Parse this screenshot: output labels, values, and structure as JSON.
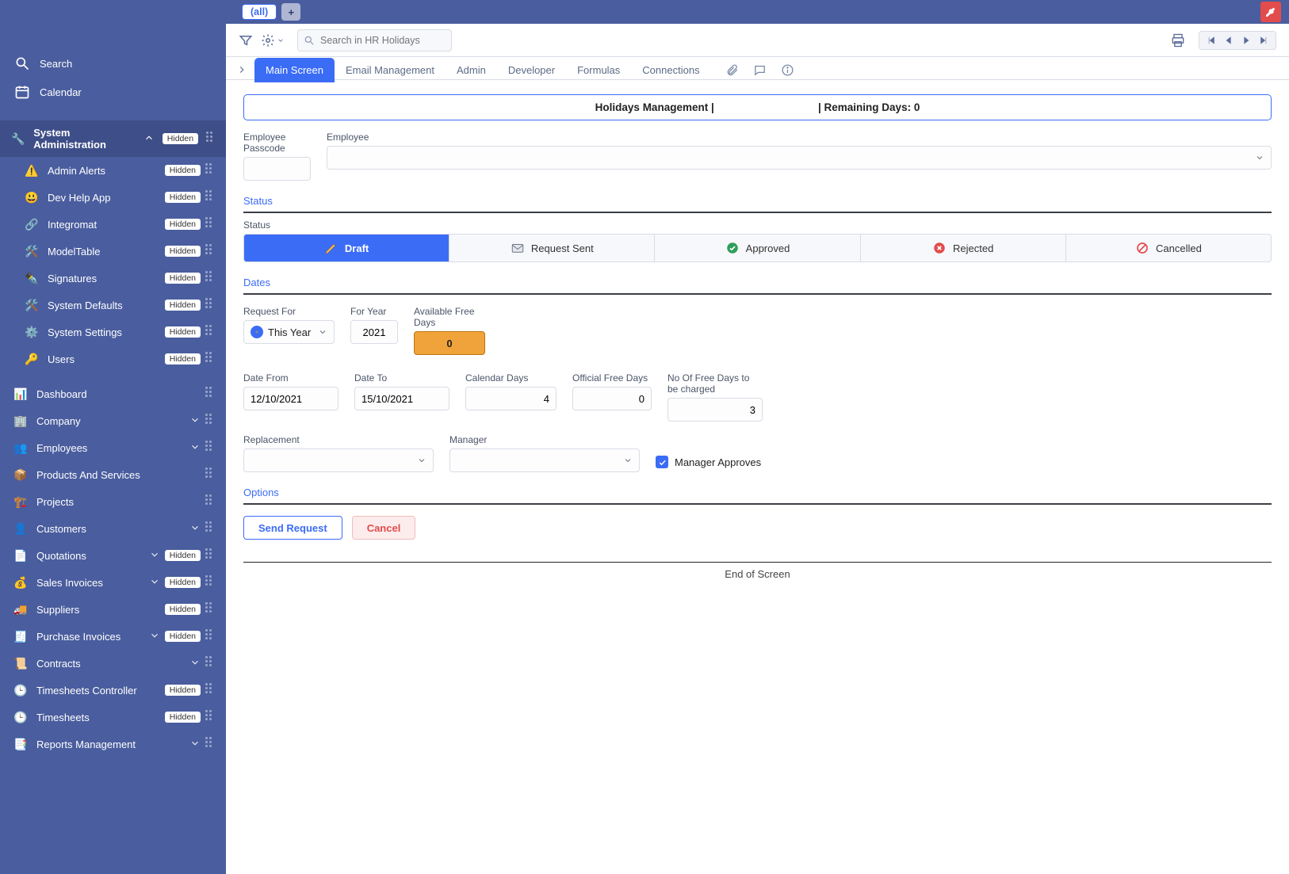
{
  "sidebar": {
    "search": "Search",
    "calendar": "Calendar",
    "groupHeader": {
      "label": "System Administration",
      "badge": "Hidden",
      "icon": "🔧"
    },
    "subitems": [
      {
        "label": "Admin Alerts",
        "badge": "Hidden",
        "icon": "⚠️"
      },
      {
        "label": "Dev Help App",
        "badge": "Hidden",
        "icon": "😃"
      },
      {
        "label": "Integromat",
        "badge": "Hidden",
        "icon": "🔗"
      },
      {
        "label": "ModelTable",
        "badge": "Hidden",
        "icon": "🛠️"
      },
      {
        "label": "Signatures",
        "badge": "Hidden",
        "icon": "✒️"
      },
      {
        "label": "System Defaults",
        "badge": "Hidden",
        "icon": "🛠️"
      },
      {
        "label": "System Settings",
        "badge": "Hidden",
        "icon": "⚙️"
      },
      {
        "label": "Users",
        "badge": "Hidden",
        "icon": "🔑"
      }
    ],
    "items": [
      {
        "label": "Dashboard",
        "icon": "📊",
        "hasChevron": false,
        "badge": null
      },
      {
        "label": "Company",
        "icon": "🏢",
        "hasChevron": true,
        "badge": null
      },
      {
        "label": "Employees",
        "icon": "👥",
        "hasChevron": true,
        "badge": null
      },
      {
        "label": "Products And Services",
        "icon": "📦",
        "hasChevron": false,
        "badge": null
      },
      {
        "label": "Projects",
        "icon": "🏗️",
        "hasChevron": false,
        "badge": null
      },
      {
        "label": "Customers",
        "icon": "👤",
        "hasChevron": true,
        "badge": null
      },
      {
        "label": "Quotations",
        "icon": "📄",
        "hasChevron": true,
        "badge": "Hidden"
      },
      {
        "label": "Sales Invoices",
        "icon": "💰",
        "hasChevron": true,
        "badge": "Hidden"
      },
      {
        "label": "Suppliers",
        "icon": "🚚",
        "hasChevron": false,
        "badge": "Hidden"
      },
      {
        "label": "Purchase Invoices",
        "icon": "🧾",
        "hasChevron": true,
        "badge": "Hidden"
      },
      {
        "label": "Contracts",
        "icon": "📜",
        "hasChevron": true,
        "badge": null
      },
      {
        "label": "Timesheets Controller",
        "icon": "🕒",
        "hasChevron": false,
        "badge": "Hidden"
      },
      {
        "label": "Timesheets",
        "icon": "🕒",
        "hasChevron": false,
        "badge": "Hidden"
      },
      {
        "label": "Reports Management",
        "icon": "📑",
        "hasChevron": true,
        "badge": null
      }
    ]
  },
  "topbar": {
    "allTab": "(all)"
  },
  "toolbar": {
    "searchPlaceholder": "Search in HR Holidays"
  },
  "tabs": {
    "items": [
      {
        "label": "Main Screen"
      },
      {
        "label": "Email Management"
      },
      {
        "label": "Admin"
      },
      {
        "label": "Developer"
      },
      {
        "label": "Formulas"
      },
      {
        "label": "Connections"
      }
    ]
  },
  "headerBanner": "Holidays Management |                                   | Remaining Days: 0",
  "form": {
    "employeePasscodeLabel": "Employee Passcode",
    "employeeLabel": "Employee",
    "statusSection": "Status",
    "statusLabel": "Status",
    "statuses": [
      {
        "label": "Draft"
      },
      {
        "label": "Request Sent"
      },
      {
        "label": "Approved"
      },
      {
        "label": "Rejected"
      },
      {
        "label": "Cancelled"
      }
    ],
    "datesSection": "Dates",
    "requestForLabel": "Request For",
    "requestForValue": "This Year",
    "forYearLabel": "For Year",
    "forYearValue": "2021",
    "availFreeLabel": "Available Free Days",
    "availFreeValue": "0",
    "dateFromLabel": "Date From",
    "dateFromValue": "12/10/2021",
    "dateToLabel": "Date To",
    "dateToValue": "15/10/2021",
    "calendarDaysLabel": "Calendar Days",
    "calendarDaysValue": "4",
    "officialFreeLabel": "Official Free Days",
    "officialFreeValue": "0",
    "chargedLabel": "No Of Free Days to be charged",
    "chargedValue": "3",
    "replacementLabel": "Replacement",
    "managerLabel": "Manager",
    "managerApprovesLabel": "Manager Approves",
    "optionsSection": "Options",
    "sendRequestLabel": "Send Request",
    "cancelLabel": "Cancel",
    "endOfScreen": "End of Screen"
  }
}
